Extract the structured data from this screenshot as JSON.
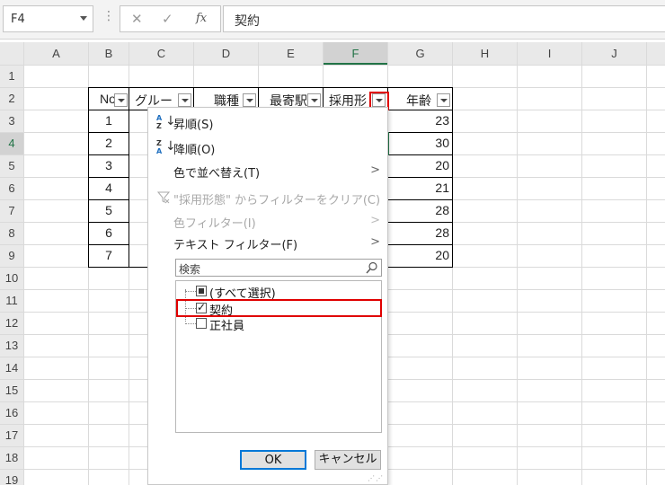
{
  "formula_bar": {
    "name_box": "F4",
    "cancel_icon": "✕",
    "enter_icon": "✓",
    "fx_label": "fx",
    "formula": "契約"
  },
  "columns": [
    "A",
    "B",
    "C",
    "D",
    "E",
    "F",
    "G",
    "H",
    "I",
    "J"
  ],
  "rows": [
    "1",
    "2",
    "3",
    "4",
    "5",
    "6",
    "7",
    "8",
    "9",
    "10",
    "11",
    "12",
    "13",
    "14",
    "15",
    "16",
    "17",
    "18",
    "19"
  ],
  "selected_column": "F",
  "selected_row": "4",
  "table": {
    "headers": [
      "No",
      "グルー",
      "職種",
      "最寄駅",
      "採用形",
      "年齢"
    ],
    "no_values": [
      "1",
      "2",
      "3",
      "4",
      "5",
      "6",
      "7"
    ],
    "age_values": [
      "23",
      "30",
      "20",
      "21",
      "28",
      "28",
      "20"
    ]
  },
  "filter_menu": {
    "sort_asc": "昇順(S)",
    "sort_desc": "降順(O)",
    "sort_by_color": "色で並べ替え(T)",
    "clear_filter": "\"採用形態\" からフィルターをクリア(C)",
    "color_filter": "色フィルター(I)",
    "text_filter": "テキスト フィルター(F)",
    "search_placeholder": "検索",
    "items": [
      {
        "label": "(すべて選択)",
        "state": "partial"
      },
      {
        "label": "契約",
        "state": "checked"
      },
      {
        "label": "正社員",
        "state": "unchecked"
      }
    ],
    "ok_label": "OK",
    "cancel_label": "キャンセル"
  },
  "colors": {
    "accent_green": "#217346",
    "highlight_red": "#e00000",
    "ok_border": "#0078d7"
  }
}
